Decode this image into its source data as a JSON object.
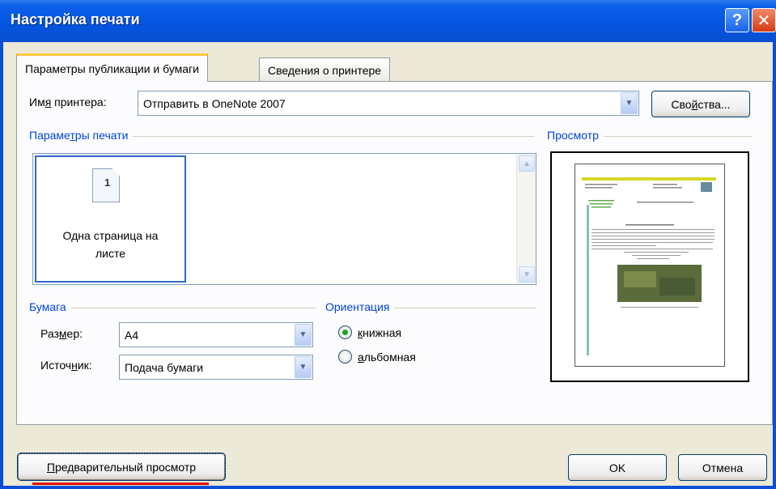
{
  "window": {
    "title": "Настройка печати"
  },
  "titlebar_buttons": {
    "help": "?",
    "close": "✕"
  },
  "tabs": [
    {
      "label": "Параметры публикации и бумаги",
      "active": true
    },
    {
      "label": "Сведения о принтере",
      "active": false
    }
  ],
  "printer": {
    "label_pre": "Им",
    "label_u": "я",
    "label_post": " принтера:",
    "value": "Отправить в OneNote 2007",
    "properties_pre": "Сво",
    "properties_u": "й",
    "properties_post": "ства..."
  },
  "print_options": {
    "title_pre": "Параме",
    "title_u": "т",
    "title_post": "ры печати",
    "selected_item_line1": "Одна страница на",
    "selected_item_line2": "листе",
    "page_icon_number": "1"
  },
  "preview": {
    "title": "Просмотр"
  },
  "paper": {
    "title": "Бумага",
    "size_pre": "Раз",
    "size_u": "м",
    "size_post": "ер:",
    "size_value": "A4",
    "source_pre": "Источ",
    "source_u": "н",
    "source_post": "ик:",
    "source_value": "Подача бумаги"
  },
  "orientation": {
    "title": "Ориентация",
    "portrait_u": "к",
    "portrait_rest": "нижная",
    "landscape_u": "а",
    "landscape_rest": "льбомная",
    "selected": "portrait"
  },
  "footer": {
    "preview_button_u": "П",
    "preview_button_rest": "редварительный просмотр",
    "ok": "OK",
    "cancel": "Отмена"
  },
  "colors": {
    "titlebar": "#0555e0",
    "group_title": "#0046d5",
    "tab_highlight": "#ffc83c",
    "radio_dot": "#21a121",
    "annotation_line": "#e00000"
  }
}
